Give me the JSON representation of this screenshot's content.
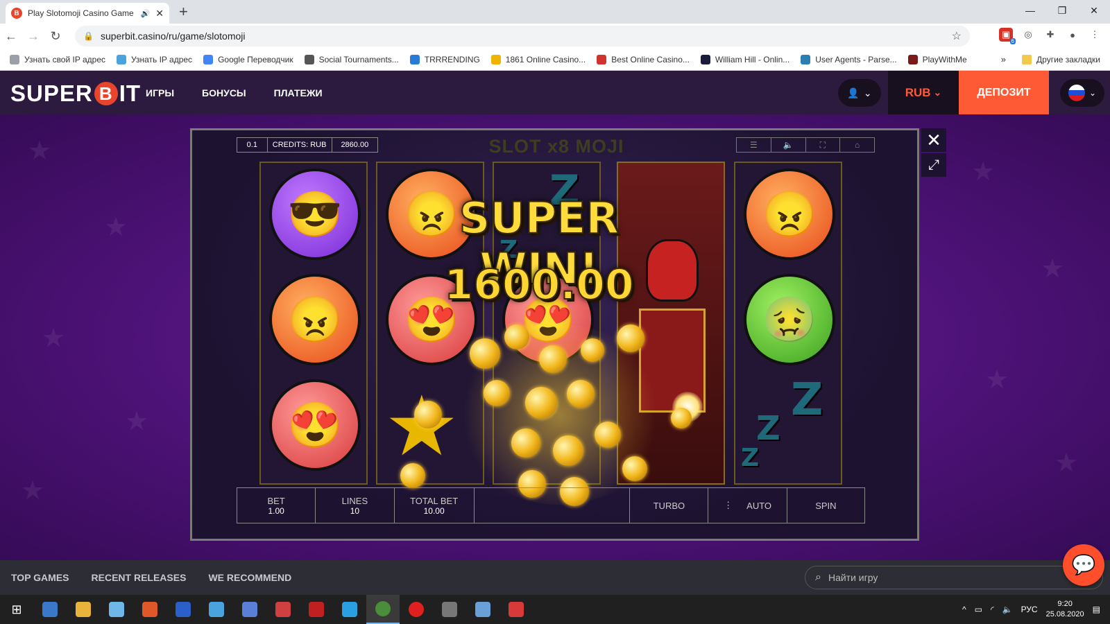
{
  "browser": {
    "tab_title": "Play Slotomoji Casino Game",
    "url": "superbit.casino/ru/game/slotomoji",
    "new_tab": "+",
    "window_controls": [
      "—",
      "❐",
      "✕"
    ],
    "extension_badge": "6",
    "bookmarks": [
      {
        "label": "Узнать свой IP адрес",
        "color": "#9aa0a6"
      },
      {
        "label": "Узнать IP адрес",
        "color": "#4aa3df"
      },
      {
        "label": "Google Переводчик",
        "color": "#4285f4"
      },
      {
        "label": "Social Tournaments...",
        "color": "#555555"
      },
      {
        "label": "TRRRENDING",
        "color": "#2b7bd6"
      },
      {
        "label": "1861 Online Casino...",
        "color": "#f0b400"
      },
      {
        "label": "Best Online Casino...",
        "color": "#d0322d"
      },
      {
        "label": "William Hill - Onlin...",
        "color": "#1b1b3a"
      },
      {
        "label": "User Agents - Parse...",
        "color": "#2a7fb0"
      },
      {
        "label": "PlayWithMe",
        "color": "#7a1a1a"
      }
    ],
    "bookmarks_more": "»",
    "other_bookmarks": "Другие закладки"
  },
  "site": {
    "logo_pre": "SUPER",
    "logo_b": "B",
    "logo_post": "IT",
    "nav": [
      "ИГРЫ",
      "БОНУСЫ",
      "ПЛАТЕЖИ"
    ],
    "currency": "RUB",
    "deposit": "ДЕПОЗИТ"
  },
  "game": {
    "coin_value": "0.1",
    "credits_label": "CREDITS: RUB",
    "credits_value": "2860.00",
    "title": "SLOT x8 MOJI",
    "win_title": "SUPER WIN!",
    "win_amount": "1600.00",
    "bet_label": "BET",
    "bet_value": "1.00",
    "lines_label": "LINES",
    "lines_value": "10",
    "total_bet_label": "TOTAL BET",
    "total_bet_value": "10.00",
    "turbo": "TURBO",
    "auto": "AUTO",
    "spin": "SPIN"
  },
  "footer": {
    "tabs": [
      "TOP GAMES",
      "RECENT RELEASES",
      "WE RECOMMEND"
    ],
    "search_placeholder": "Найти игру"
  },
  "taskbar": {
    "lang": "РУС",
    "time": "9:20",
    "date": "25.08.2020",
    "apps": [
      "#3a78c9",
      "#e8b33a",
      "#6fb7e6",
      "#e0572a",
      "#2b5fc9",
      "#4aa3df",
      "#5a7fd6",
      "#d04040",
      "#c02020",
      "#2aa0e0",
      "#4a8d3a",
      "#e02020",
      "#777777",
      "#6aa0d8",
      "#d83a3a"
    ]
  }
}
